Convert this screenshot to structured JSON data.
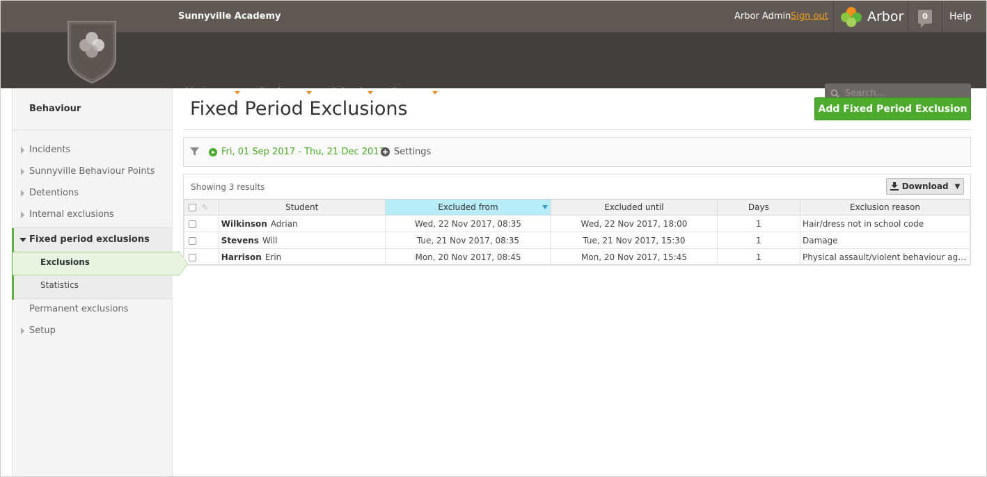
{
  "header": {
    "school_name": "Sunnyville Academy",
    "user_name": "Arbor Admin",
    "sign_out": "Sign out",
    "brand": "Arbor",
    "notification_count": "0",
    "help": "Help"
  },
  "nav": {
    "items": [
      {
        "label": "My Items"
      },
      {
        "label": "Students"
      },
      {
        "label": "School"
      },
      {
        "label": "System"
      }
    ],
    "search_placeholder": "Search..."
  },
  "sidebar": {
    "title": "Behaviour",
    "items": [
      {
        "label": "Incidents"
      },
      {
        "label": "Sunnyville Behaviour Points"
      },
      {
        "label": "Detentions"
      },
      {
        "label": "Internal exclusions"
      },
      {
        "label": "Fixed period exclusions"
      },
      {
        "label": "Exclusions"
      },
      {
        "label": "Statistics"
      },
      {
        "label": "Permanent exclusions"
      },
      {
        "label": "Setup"
      }
    ]
  },
  "main": {
    "title": "Fixed Period Exclusions",
    "add_button": "Add Fixed Period Exclusion",
    "date_range": "Fri, 01 Sep 2017 - Thu, 21 Dec 2017",
    "settings": "Settings",
    "results_text": "Showing 3 results",
    "download": "Download"
  },
  "table": {
    "columns": [
      "Student",
      "Excluded from",
      "Excluded until",
      "Days",
      "Exclusion reason"
    ],
    "rows": [
      {
        "last": "Wilkinson",
        "first": "Adrian",
        "from": "Wed, 22 Nov 2017, 08:35",
        "until": "Wed, 22 Nov 2017, 18:00",
        "days": "1",
        "reason": "Hair/dress not in school code"
      },
      {
        "last": "Stevens",
        "first": "Will",
        "from": "Tue, 21 Nov 2017, 08:35",
        "until": "Tue, 21 Nov 2017, 15:30",
        "days": "1",
        "reason": "Damage"
      },
      {
        "last": "Harrison",
        "first": "Erin",
        "from": "Mon, 20 Nov 2017, 08:45",
        "until": "Mon, 20 Nov 2017, 15:45",
        "days": "1",
        "reason": "Physical assault/violent behaviour again..."
      }
    ]
  },
  "colors": {
    "topbar": "#5f5853",
    "navbar": "#46403c",
    "accent_green": "#4caa2c",
    "accent_orange": "#f0901a",
    "sorted_header": "#b8ecf6"
  },
  "icons": {
    "logo": "school-shield-icon",
    "brand": "arbor-logo-icon",
    "notifications": "speech-bubble-icon",
    "search": "search-icon",
    "filter": "funnel-icon",
    "date": "play-circle-icon",
    "settings": "plus-circle-icon",
    "download": "download-icon"
  }
}
